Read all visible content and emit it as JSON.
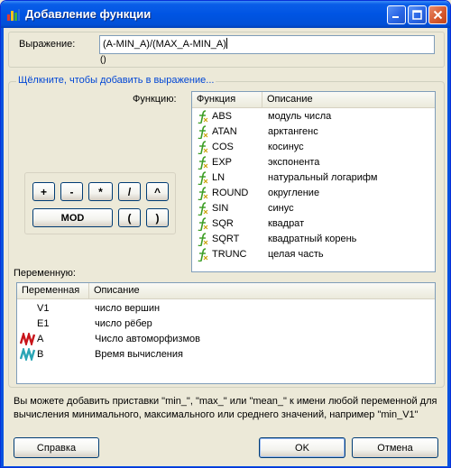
{
  "window": {
    "title": "Добавление функции"
  },
  "expression": {
    "label": "Выражение:",
    "value": "(A-MIN_A)/(MAX_A-MIN_A)",
    "parens_hint": "()"
  },
  "group_title": "Щёлкните, чтобы добавить в выражение...",
  "operators": {
    "plus": "+",
    "minus": "-",
    "mult": "*",
    "div": "/",
    "pow": "^",
    "mod": "MOD",
    "lparen": "(",
    "rparen": ")"
  },
  "functions": {
    "label": "Функцию:",
    "columns": [
      "Функция",
      "Описание"
    ],
    "rows": [
      {
        "name": "ABS",
        "desc": "модуль числа"
      },
      {
        "name": "ATAN",
        "desc": "арктангенс"
      },
      {
        "name": "COS",
        "desc": "косинус"
      },
      {
        "name": "EXP",
        "desc": "экспонента"
      },
      {
        "name": "LN",
        "desc": "натуральный логарифм"
      },
      {
        "name": "ROUND",
        "desc": "округление"
      },
      {
        "name": "SIN",
        "desc": "синус"
      },
      {
        "name": "SQR",
        "desc": "квадрат"
      },
      {
        "name": "SQRT",
        "desc": "квадратный корень"
      },
      {
        "name": "TRUNC",
        "desc": "целая часть"
      }
    ]
  },
  "variables": {
    "label": "Переменную:",
    "columns": [
      "Переменная",
      "Описание"
    ],
    "rows": [
      {
        "name": "V1",
        "desc": "число вершин",
        "icon": "none"
      },
      {
        "name": "E1",
        "desc": "число рёбер",
        "icon": "none"
      },
      {
        "name": "A",
        "desc": "Число автоморфизмов",
        "icon": "red-graph-icon"
      },
      {
        "name": "B",
        "desc": "Время вычисления",
        "icon": "teal-graph-icon"
      }
    ]
  },
  "hint_text": "Вы можете добавить приставки \"min_\", \"max_\" или \"mean_\" к имени любой переменной для вычисления минимального, максимального или среднего значений, например \"min_V1\"",
  "buttons": {
    "help": "Справка",
    "ok": "OK",
    "cancel": "Отмена"
  },
  "colors": {
    "titlebar": "#0054e3",
    "group_title": "#0046d5",
    "dialog_bg": "#ece9d8"
  }
}
